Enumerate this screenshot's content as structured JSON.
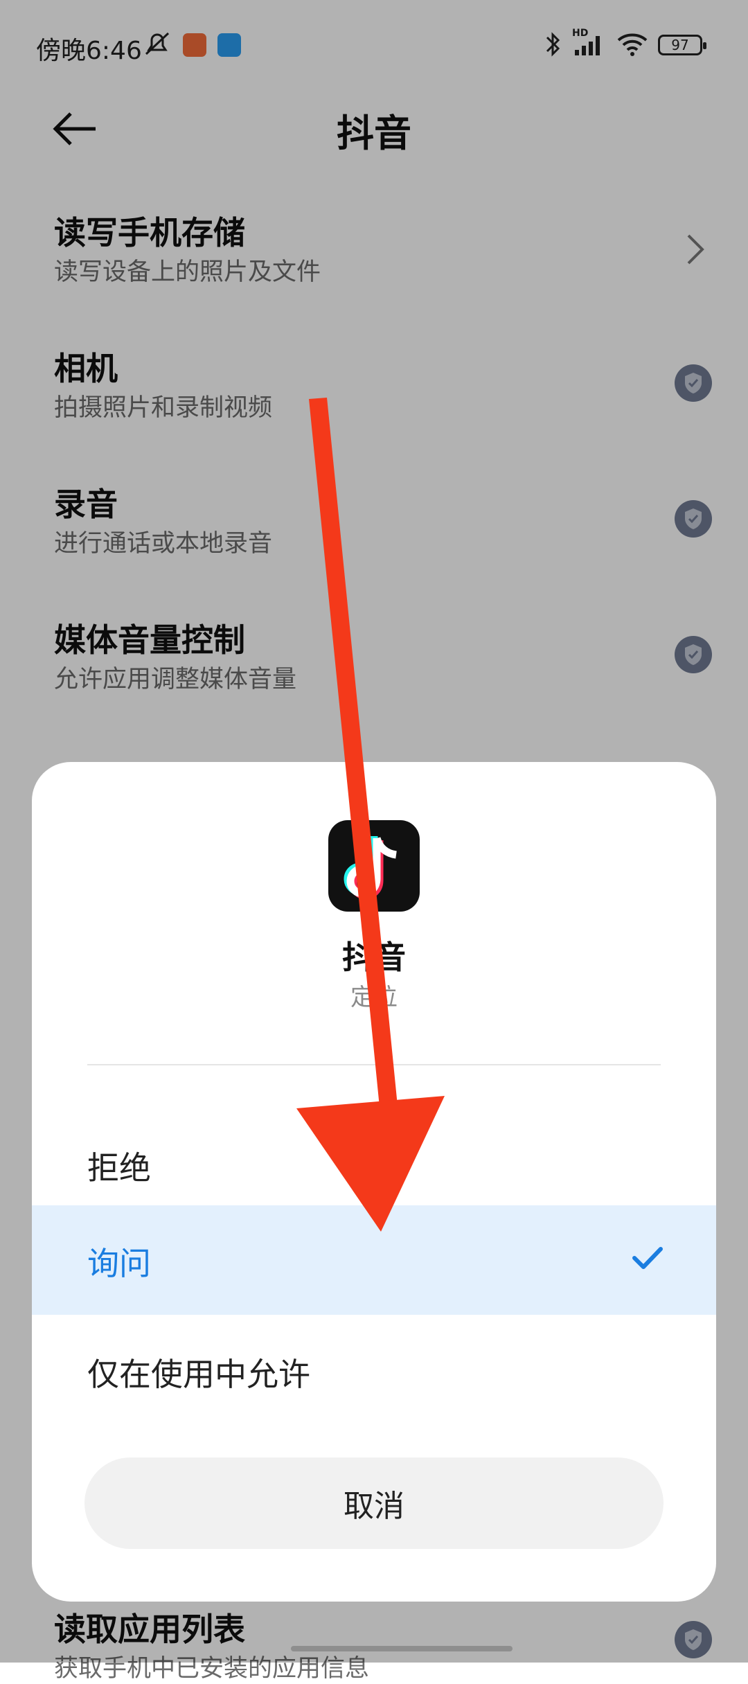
{
  "status_bar": {
    "time": "傍晚6:46",
    "battery": "97",
    "network_label": "HD"
  },
  "header": {
    "title": "抖音"
  },
  "permissions": [
    {
      "title": "读写手机存储",
      "subtitle": "读写设备上的照片及文件",
      "right": "chevron"
    },
    {
      "title": "相机",
      "subtitle": "拍摄照片和录制视频",
      "right": "shield"
    },
    {
      "title": "录音",
      "subtitle": "进行通话或本地录音",
      "right": "shield"
    },
    {
      "title": "媒体音量控制",
      "subtitle": "允许应用调整媒体音量",
      "right": "shield"
    },
    {
      "title": "读取应用列表",
      "subtitle": "获取手机中已安装的应用信息",
      "right": "shield"
    }
  ],
  "dialog": {
    "app_name": "抖音",
    "app_permission": "定位",
    "options": [
      {
        "label": "拒绝",
        "selected": false
      },
      {
        "label": "询问",
        "selected": true
      },
      {
        "label": "仅在使用中允许",
        "selected": false
      }
    ],
    "cancel_label": "取消"
  },
  "colors": {
    "accent": "#1a7de0",
    "selected_bg": "#e3f0fd",
    "annotation_arrow": "#f4391a"
  }
}
